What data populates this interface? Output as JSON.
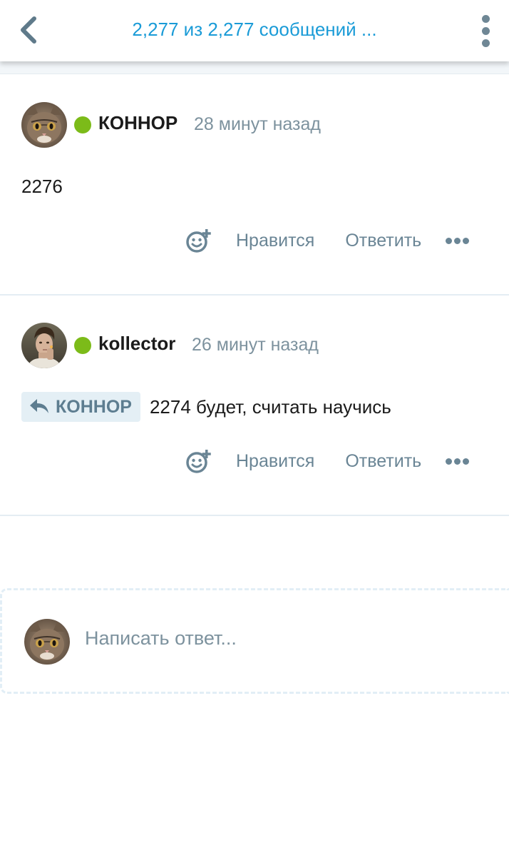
{
  "header": {
    "title": "2,277 из 2,277 сообщений ...",
    "back_icon": "chevron-left-icon",
    "menu_icon": "vertical-dots-icon"
  },
  "posts": [
    {
      "author": "КОННОР",
      "time": "28 минут назад",
      "text": "2276",
      "online": true
    },
    {
      "author": "kollector",
      "time": "26 минут назад",
      "reply_to": "КОННОР",
      "text": "2274 будет, считать научись",
      "online": true
    }
  ],
  "actions": {
    "react_icon": "add-reaction-icon",
    "like_label": "Нравится",
    "reply_label": "Ответить",
    "more_icon": "more-horizontal-icon"
  },
  "compose": {
    "placeholder": "Написать ответ..."
  },
  "colors": {
    "accent": "#1a9bd7",
    "online": "#7cbb19",
    "muted": "#7d929e",
    "action": "#6a8595",
    "chip_bg": "#e4eff5"
  }
}
